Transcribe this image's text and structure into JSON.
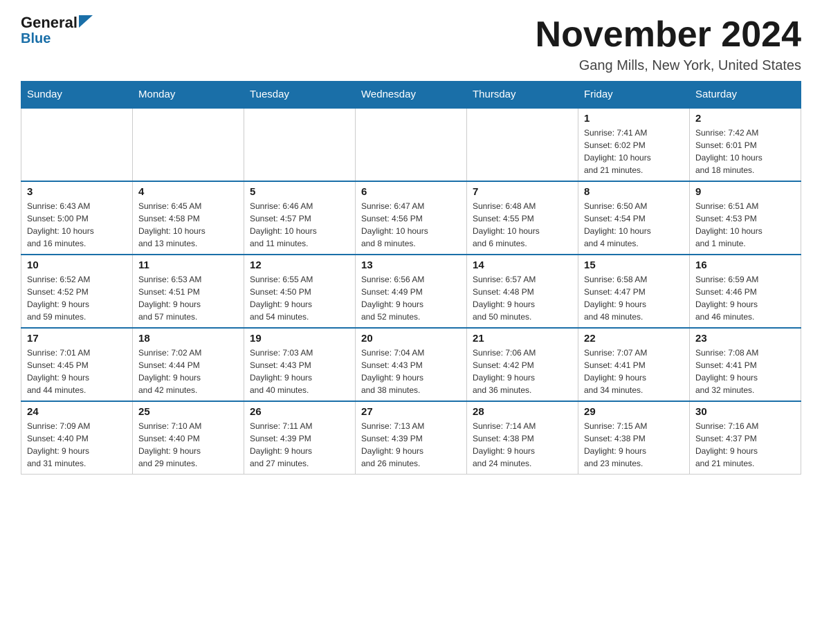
{
  "header": {
    "logo_general": "General",
    "logo_blue": "Blue",
    "title": "November 2024",
    "subtitle": "Gang Mills, New York, United States"
  },
  "weekdays": [
    "Sunday",
    "Monday",
    "Tuesday",
    "Wednesday",
    "Thursday",
    "Friday",
    "Saturday"
  ],
  "weeks": [
    [
      {
        "day": "",
        "info": ""
      },
      {
        "day": "",
        "info": ""
      },
      {
        "day": "",
        "info": ""
      },
      {
        "day": "",
        "info": ""
      },
      {
        "day": "",
        "info": ""
      },
      {
        "day": "1",
        "info": "Sunrise: 7:41 AM\nSunset: 6:02 PM\nDaylight: 10 hours\nand 21 minutes."
      },
      {
        "day": "2",
        "info": "Sunrise: 7:42 AM\nSunset: 6:01 PM\nDaylight: 10 hours\nand 18 minutes."
      }
    ],
    [
      {
        "day": "3",
        "info": "Sunrise: 6:43 AM\nSunset: 5:00 PM\nDaylight: 10 hours\nand 16 minutes."
      },
      {
        "day": "4",
        "info": "Sunrise: 6:45 AM\nSunset: 4:58 PM\nDaylight: 10 hours\nand 13 minutes."
      },
      {
        "day": "5",
        "info": "Sunrise: 6:46 AM\nSunset: 4:57 PM\nDaylight: 10 hours\nand 11 minutes."
      },
      {
        "day": "6",
        "info": "Sunrise: 6:47 AM\nSunset: 4:56 PM\nDaylight: 10 hours\nand 8 minutes."
      },
      {
        "day": "7",
        "info": "Sunrise: 6:48 AM\nSunset: 4:55 PM\nDaylight: 10 hours\nand 6 minutes."
      },
      {
        "day": "8",
        "info": "Sunrise: 6:50 AM\nSunset: 4:54 PM\nDaylight: 10 hours\nand 4 minutes."
      },
      {
        "day": "9",
        "info": "Sunrise: 6:51 AM\nSunset: 4:53 PM\nDaylight: 10 hours\nand 1 minute."
      }
    ],
    [
      {
        "day": "10",
        "info": "Sunrise: 6:52 AM\nSunset: 4:52 PM\nDaylight: 9 hours\nand 59 minutes."
      },
      {
        "day": "11",
        "info": "Sunrise: 6:53 AM\nSunset: 4:51 PM\nDaylight: 9 hours\nand 57 minutes."
      },
      {
        "day": "12",
        "info": "Sunrise: 6:55 AM\nSunset: 4:50 PM\nDaylight: 9 hours\nand 54 minutes."
      },
      {
        "day": "13",
        "info": "Sunrise: 6:56 AM\nSunset: 4:49 PM\nDaylight: 9 hours\nand 52 minutes."
      },
      {
        "day": "14",
        "info": "Sunrise: 6:57 AM\nSunset: 4:48 PM\nDaylight: 9 hours\nand 50 minutes."
      },
      {
        "day": "15",
        "info": "Sunrise: 6:58 AM\nSunset: 4:47 PM\nDaylight: 9 hours\nand 48 minutes."
      },
      {
        "day": "16",
        "info": "Sunrise: 6:59 AM\nSunset: 4:46 PM\nDaylight: 9 hours\nand 46 minutes."
      }
    ],
    [
      {
        "day": "17",
        "info": "Sunrise: 7:01 AM\nSunset: 4:45 PM\nDaylight: 9 hours\nand 44 minutes."
      },
      {
        "day": "18",
        "info": "Sunrise: 7:02 AM\nSunset: 4:44 PM\nDaylight: 9 hours\nand 42 minutes."
      },
      {
        "day": "19",
        "info": "Sunrise: 7:03 AM\nSunset: 4:43 PM\nDaylight: 9 hours\nand 40 minutes."
      },
      {
        "day": "20",
        "info": "Sunrise: 7:04 AM\nSunset: 4:43 PM\nDaylight: 9 hours\nand 38 minutes."
      },
      {
        "day": "21",
        "info": "Sunrise: 7:06 AM\nSunset: 4:42 PM\nDaylight: 9 hours\nand 36 minutes."
      },
      {
        "day": "22",
        "info": "Sunrise: 7:07 AM\nSunset: 4:41 PM\nDaylight: 9 hours\nand 34 minutes."
      },
      {
        "day": "23",
        "info": "Sunrise: 7:08 AM\nSunset: 4:41 PM\nDaylight: 9 hours\nand 32 minutes."
      }
    ],
    [
      {
        "day": "24",
        "info": "Sunrise: 7:09 AM\nSunset: 4:40 PM\nDaylight: 9 hours\nand 31 minutes."
      },
      {
        "day": "25",
        "info": "Sunrise: 7:10 AM\nSunset: 4:40 PM\nDaylight: 9 hours\nand 29 minutes."
      },
      {
        "day": "26",
        "info": "Sunrise: 7:11 AM\nSunset: 4:39 PM\nDaylight: 9 hours\nand 27 minutes."
      },
      {
        "day": "27",
        "info": "Sunrise: 7:13 AM\nSunset: 4:39 PM\nDaylight: 9 hours\nand 26 minutes."
      },
      {
        "day": "28",
        "info": "Sunrise: 7:14 AM\nSunset: 4:38 PM\nDaylight: 9 hours\nand 24 minutes."
      },
      {
        "day": "29",
        "info": "Sunrise: 7:15 AM\nSunset: 4:38 PM\nDaylight: 9 hours\nand 23 minutes."
      },
      {
        "day": "30",
        "info": "Sunrise: 7:16 AM\nSunset: 4:37 PM\nDaylight: 9 hours\nand 21 minutes."
      }
    ]
  ]
}
